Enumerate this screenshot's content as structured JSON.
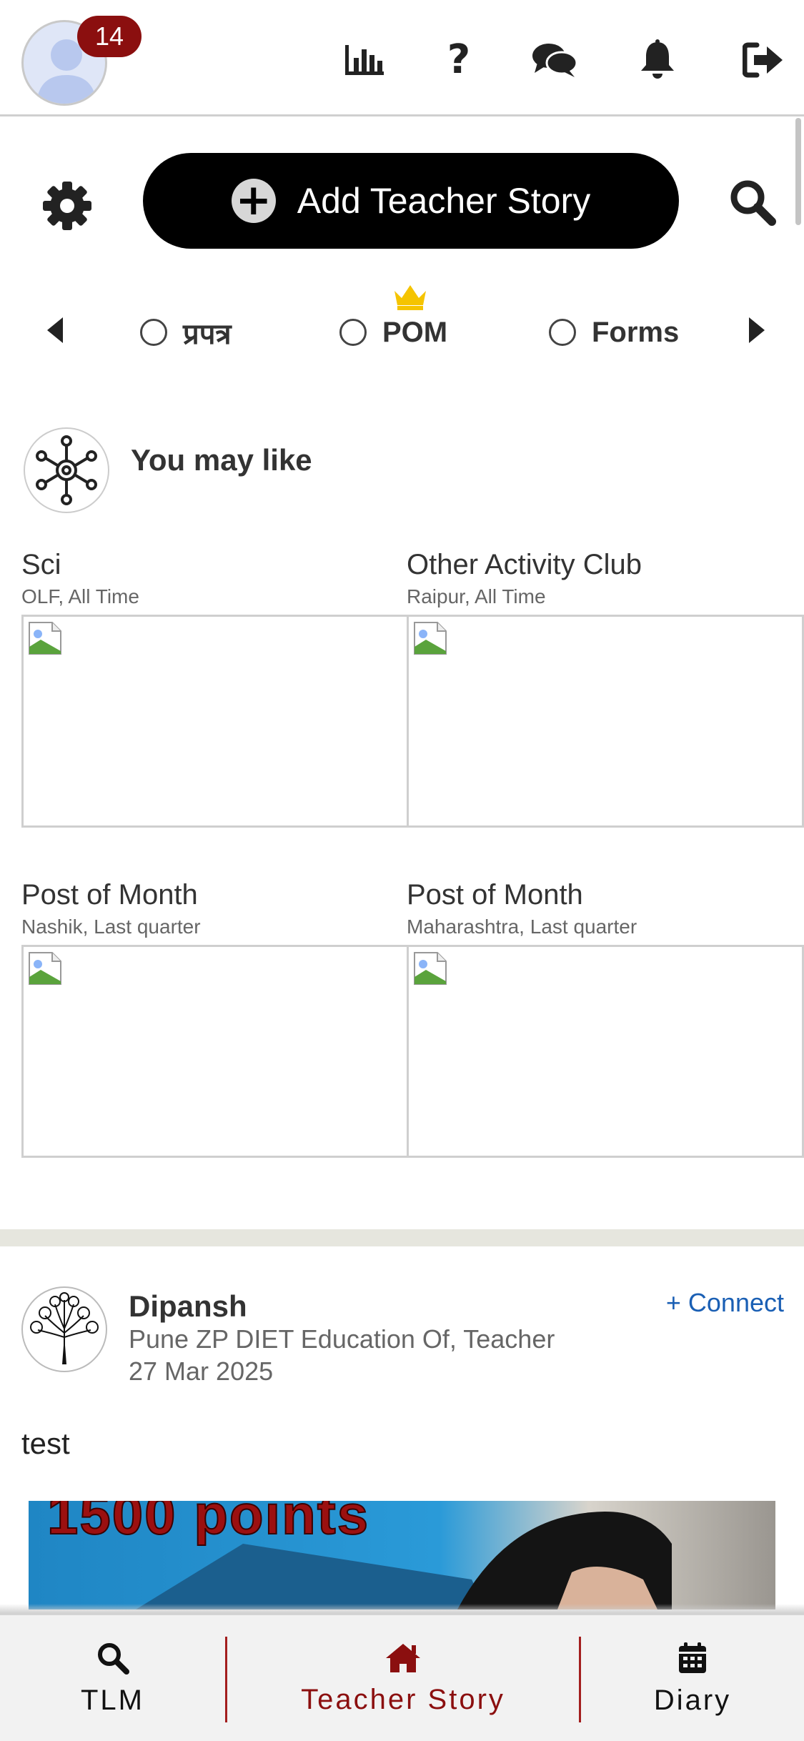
{
  "header": {
    "notification_count": "14",
    "icons": [
      "stats-icon",
      "help-icon",
      "chat-icon",
      "bell-icon",
      "logout-icon"
    ],
    "help_glyph": "?"
  },
  "actions": {
    "add_story_label": "Add Teacher Story"
  },
  "filters": {
    "options": [
      {
        "label": "प्रपत्र",
        "selected": false
      },
      {
        "label": "POM",
        "selected": false,
        "premium": true
      },
      {
        "label": "Forms",
        "selected": false
      }
    ]
  },
  "you_may_like": {
    "title": "You may like",
    "cards": [
      {
        "title": "Sci",
        "subtitle": "OLF, All Time"
      },
      {
        "title": "Other Activity Club",
        "subtitle": "Raipur, All Time"
      },
      {
        "title": "Post of Month",
        "subtitle": "Nashik, Last quarter"
      },
      {
        "title": "Post of Month",
        "subtitle": "Maharashtra, Last quarter"
      }
    ]
  },
  "post": {
    "author": "Dipansh",
    "role": "Pune ZP DIET Education Of, Teacher",
    "date": "27 Mar 2025",
    "connect_label": "+ Connect",
    "text": "test",
    "image_text": "1500 points"
  },
  "bottom_nav": {
    "items": [
      {
        "label": "TLM",
        "icon": "search-icon",
        "active": false
      },
      {
        "label": "Teacher Story",
        "icon": "home-icon",
        "active": true
      },
      {
        "label": "Diary",
        "icon": "calendar-icon",
        "active": false
      }
    ]
  },
  "colors": {
    "accent": "#8b0f0f",
    "link": "#1a5fb4",
    "crown": "#f5c400",
    "divider": "#e6e6de"
  }
}
